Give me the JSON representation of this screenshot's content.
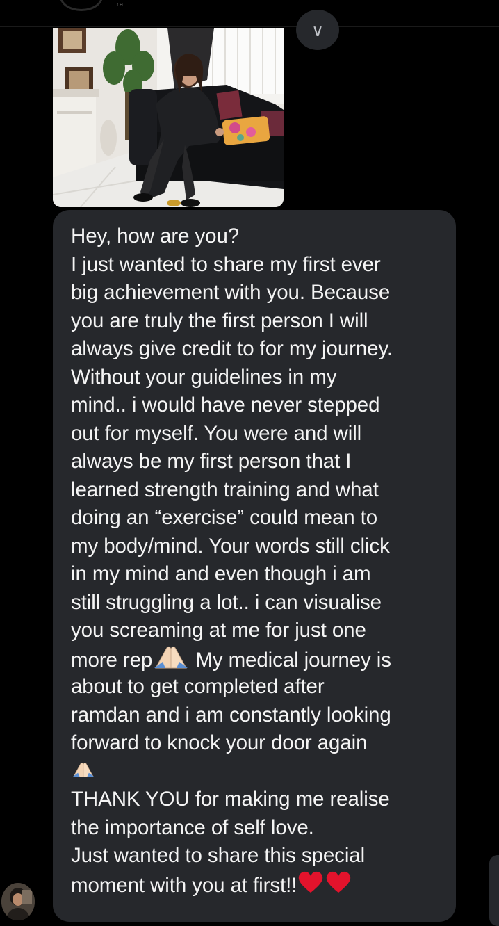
{
  "header": {
    "username_partial": "ra.....................................",
    "jump_icon": "chevron-down-icon"
  },
  "media": {
    "photo_icon": "shared-photo"
  },
  "message": {
    "lines": [
      "Hey, how are you?",
      "I just wanted to share my first ever",
      "big achievement with you. Because",
      "you are truly the first person I will",
      "always give credit to for my journey.",
      "Without your guidelines in my",
      "mind.. i would have never stepped",
      "out for myself. You were and will",
      "always be my first person that I",
      "learned strength training and what",
      "doing an “exercise” could mean to",
      "my body/mind. Your words still click",
      "in my mind and even though i am",
      "still struggling a lot.. i can visualise",
      "you screaming at me for just one"
    ],
    "line_rep_before": "more rep",
    "line_rep_after": " My medical journey is",
    "lines_b": [
      "about to get completed after",
      "ramdan and i am constantly looking",
      "forward to knock your door again"
    ],
    "lines_c": [
      "THANK YOU for making me realise",
      "the importance of self love.",
      "Just wanted to share this special"
    ],
    "last_line": "moment with you at first!!",
    "emoji": {
      "pray": "folded-hands-emoji",
      "heart": "red-heart-emoji"
    }
  },
  "colors": {
    "background": "#000000",
    "bubble": "#26282c",
    "text": "#f4f4f4"
  }
}
